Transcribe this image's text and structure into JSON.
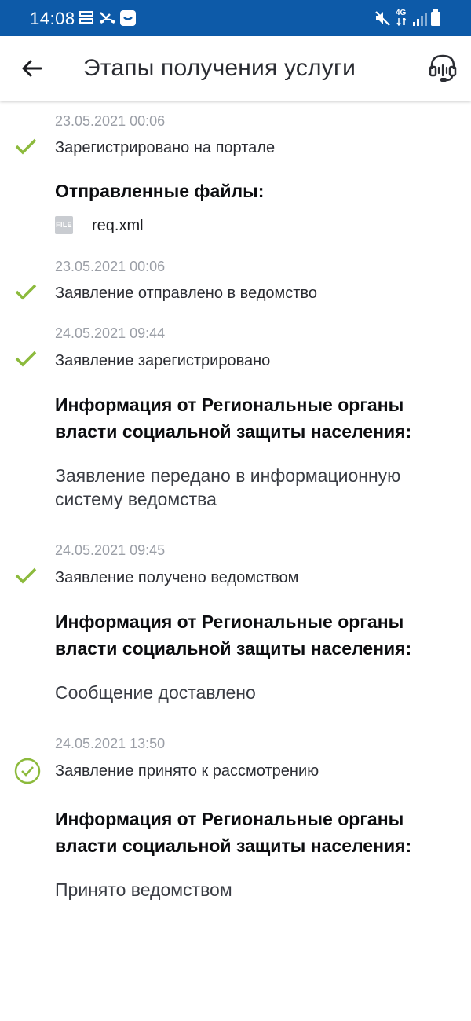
{
  "status_bar": {
    "time": "14:08",
    "network": "4G"
  },
  "app_bar": {
    "title": "Этапы получения услуги"
  },
  "colors": {
    "status_bar_bg": "#0d5aa8",
    "check_green": "#8cba3c",
    "date_gray": "#9a9ea6"
  },
  "stages": [
    {
      "date": "23.05.2021 00:06",
      "status": "Зарегистрировано на портале",
      "icon": "check-icon"
    },
    {
      "date": "23.05.2021 00:06",
      "status": "Заявление отправлено в ведомство",
      "icon": "check-icon"
    },
    {
      "date": "24.05.2021 09:44",
      "status": "Заявление зарегистрировано",
      "icon": "check-icon"
    },
    {
      "date": "24.05.2021 09:45",
      "status": "Заявление получено ведомством",
      "icon": "check-icon"
    },
    {
      "date": "24.05.2021 13:50",
      "status": "Заявление принято к рассмотрению",
      "icon": "check-circle-icon"
    }
  ],
  "files": {
    "title": "Отправленные файлы:",
    "items": [
      {
        "badge": "FILE",
        "name": "req.xml"
      }
    ]
  },
  "info": [
    {
      "title": "Информация от Региональные органы власти социальной защиты населения:",
      "text": "Заявление передано в информационную систему ведомства"
    },
    {
      "title": "Информация от Региональные органы власти социальной защиты населения:",
      "text": "Сообщение доставлено"
    },
    {
      "title": "Информация от Региональные органы власти социальной защиты населения:",
      "text": "Принято ведомством"
    }
  ]
}
